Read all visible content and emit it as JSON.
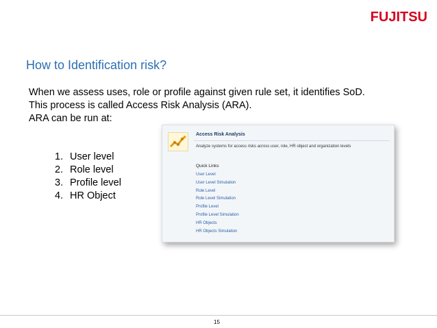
{
  "brand": {
    "logo_text": "FUJITSU",
    "logo_color": "#d6001c"
  },
  "slide": {
    "title": "How to Identification risk?",
    "paragraph": [
      "When we assess uses, role or profile against given rule set, it identifies SoD.",
      "This process is called Access Risk Analysis (ARA).",
      "ARA can be run at:"
    ],
    "levels": [
      {
        "num": "1.",
        "label": "User level"
      },
      {
        "num": "2.",
        "label": "Role level"
      },
      {
        "num": "3.",
        "label": "Profile level"
      },
      {
        "num": "4.",
        "label": "HR Object"
      }
    ],
    "page_number": "15"
  },
  "screenshot": {
    "heading": "Access Risk Analysis",
    "description": "Analyze systems for access risks across user, role, HR object and organization levels",
    "quick_links_label": "Quick Links",
    "links": [
      "User Level",
      "User Level Simulation",
      "Role Level",
      "Role Level Simulation",
      "Profile Level",
      "Profile Level Simulation",
      "HR Objects",
      "HR Objects Simulation"
    ],
    "icon": "trend-chart-icon"
  },
  "colors": {
    "title": "#2b6fb3",
    "link": "#2a5fa8"
  }
}
